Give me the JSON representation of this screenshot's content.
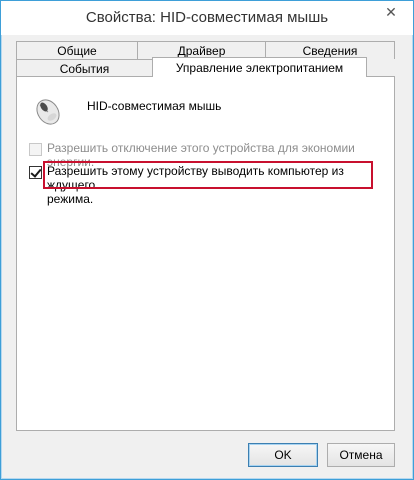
{
  "window": {
    "title": "Свойства: HID-совместимая мышь",
    "close": "✕"
  },
  "tabs_top": [
    {
      "label": "Общие"
    },
    {
      "label": "Драйвер"
    },
    {
      "label": "Сведения"
    }
  ],
  "tabs_bottom": [
    {
      "label": "События"
    },
    {
      "label": "Управление электропитанием",
      "active": true
    }
  ],
  "panel": {
    "device_icon": "mouse-icon",
    "device_name": "HID-совместимая мышь",
    "options": [
      {
        "label": "Разрешить отключение этого устройства для экономии энергии.",
        "checked": false,
        "disabled": true
      },
      {
        "label_line1": "Разрешить этому устройству выводить компьютер из ждущего",
        "label_line2": "режима.",
        "checked": true,
        "disabled": false
      }
    ]
  },
  "buttons": {
    "ok": "OK",
    "cancel": "Отмена"
  },
  "colors": {
    "highlight": "#c8102e",
    "window_border": "#3e9fd8"
  }
}
